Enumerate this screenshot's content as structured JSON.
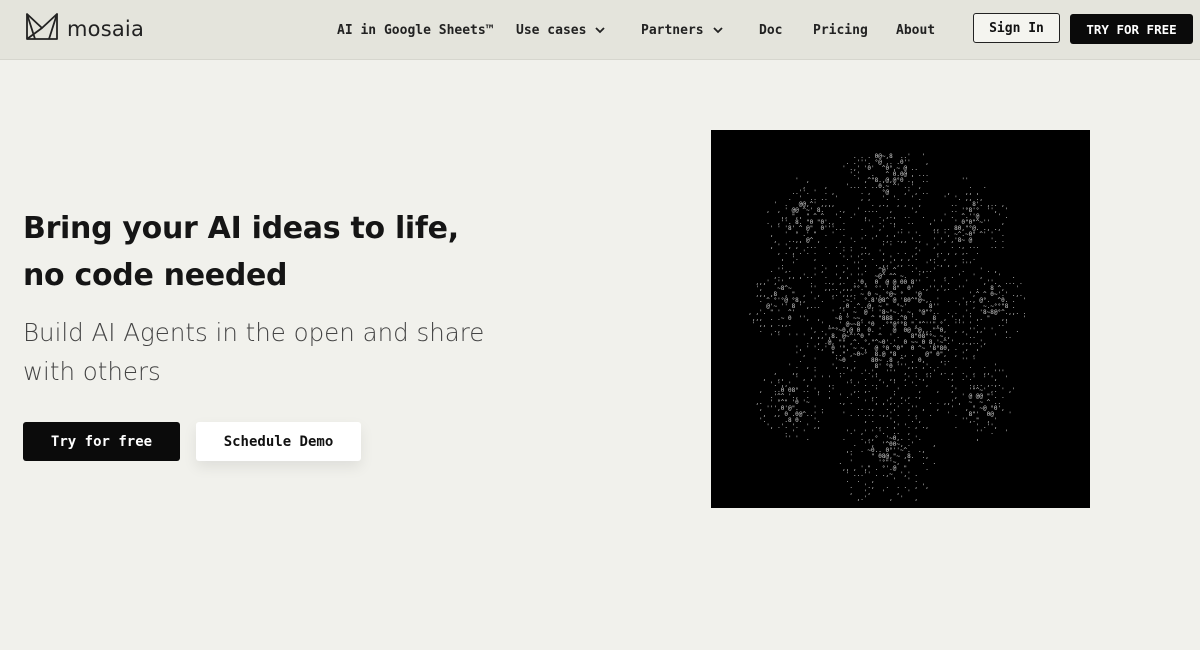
{
  "brand": {
    "name": "mosaia",
    "logo_icon": "mosaia-logo-icon"
  },
  "nav": {
    "items": [
      {
        "label": "AI in Google Sheets™",
        "has_dropdown": false
      },
      {
        "label": "Use cases",
        "has_dropdown": true
      },
      {
        "label": "Partners",
        "has_dropdown": true
      },
      {
        "label": "Doc",
        "has_dropdown": false
      },
      {
        "label": "Pricing",
        "has_dropdown": false
      },
      {
        "label": "About",
        "has_dropdown": false
      }
    ],
    "sign_in_label": "Sign In",
    "try_free_label": "TRY FOR FREE"
  },
  "hero": {
    "title": "Bring your AI ideas to life, no code needed",
    "subtitle": "Build AI Agents in the open and share with others",
    "primary_cta": "Try for free",
    "secondary_cta": "Schedule Demo"
  },
  "visual": {
    "type": "ascii-art-animation",
    "background": "#000000",
    "glyph_color": "#cfcfcf"
  },
  "colors": {
    "page_bg": "#f1f1ec",
    "nav_bg": "#e4e4dc",
    "primary": "#0b0b0b"
  }
}
